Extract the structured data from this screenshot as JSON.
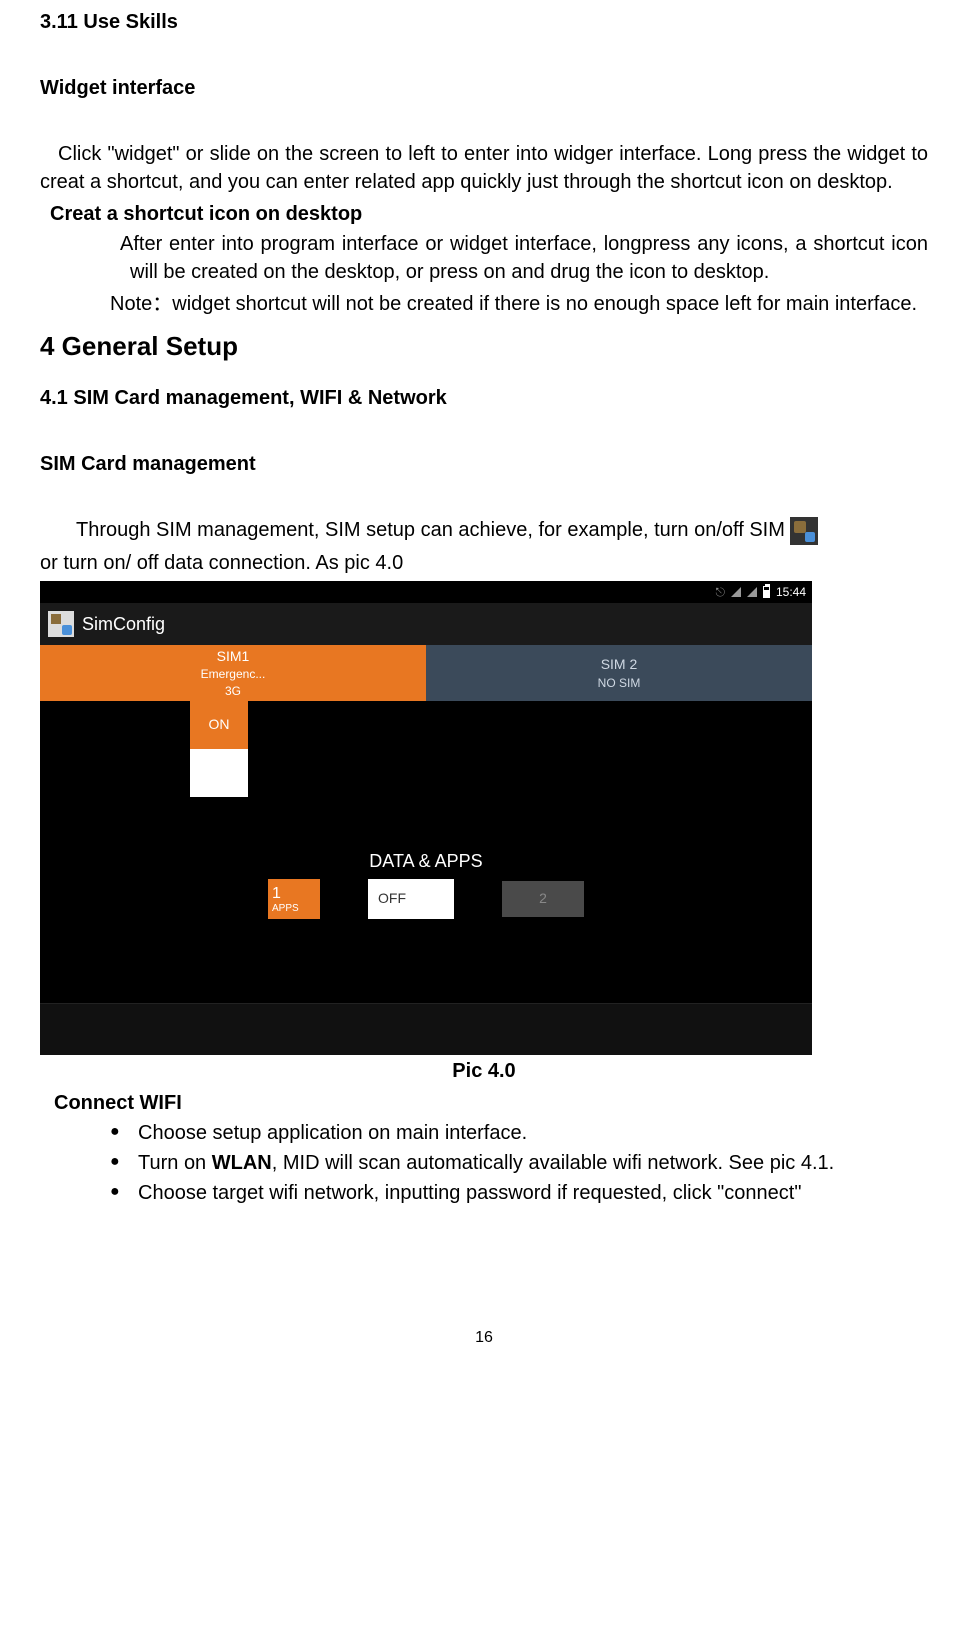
{
  "headings": {
    "s311": "3.11 Use Skills",
    "widget_interface": "Widget interface",
    "creat_shortcut": "Creat a shortcut icon on desktop",
    "general_setup": "4 General Setup",
    "s41": "4.1 SIM Card management, WIFI & Network",
    "sim_mgmt": "SIM Card management",
    "connect_wifi": "Connect WIFI",
    "pic_caption": "Pic 4.0"
  },
  "paragraphs": {
    "widget_p": "Click \"widget\" or slide on the screen to left to enter into widger interface. Long press the widget to creat a shortcut, and you can enter related app quickly just through the shortcut icon on desktop.",
    "shortcut_p1": "After enter into program interface or widget interface, longpress any icons, a shortcut icon will be created on the desktop, or press on and drug the icon to desktop.",
    "shortcut_note": "Note：widget shortcut will not be created if there is no enough space left for main interface.",
    "sim_p_before": "Through SIM management, SIM setup can achieve, for example, turn on/off SIM",
    "sim_p_after": "or turn on/ off data connection. As pic 4.0"
  },
  "screenshot": {
    "statusbar": {
      "time": "15:44"
    },
    "appbar": {
      "title": "SimConfig"
    },
    "tabs": {
      "sim1": {
        "name": "SIM1",
        "line2": "Emergenc...",
        "line3": "3G"
      },
      "sim2": {
        "name": "SIM 2",
        "line2": "NO SIM"
      }
    },
    "switch": {
      "on": "ON"
    },
    "data_label": "DATA & APPS",
    "bottom": {
      "apps": "APPS",
      "off": "OFF",
      "two": "2"
    }
  },
  "bullets": {
    "b1": "Choose setup application on main interface.",
    "b2_pre": "Turn on ",
    "b2_bold": "WLAN",
    "b2_post": ", MID will scan automatically available wifi network. See pic 4.1.",
    "b3": "Choose target wifi network, inputting password if requested, click \"connect\""
  },
  "page_number": "16"
}
